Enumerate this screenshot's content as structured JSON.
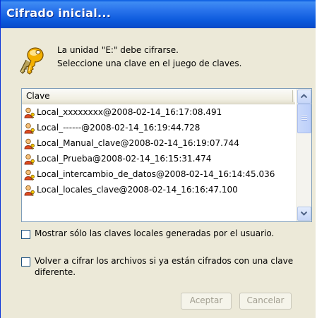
{
  "window": {
    "title": "Cifrado inicial..."
  },
  "message": {
    "line1": "La unidad \"E:\" debe cifrarse.",
    "line2": "Seleccione una clave en el juego de claves."
  },
  "key_list": {
    "column_header": "Clave",
    "items": [
      {
        "label": "Local_xxxxxxxx@2008-02-14_16:17:08.491",
        "icon": "user-key-icon"
      },
      {
        "label": "Local_------@2008-02-14_16:19:44.728",
        "icon": "user-key-icon"
      },
      {
        "label": "Local_Manual_clave@2008-02-14_16:19:07.744",
        "icon": "user-key-icon"
      },
      {
        "label": "Local_Prueba@2008-02-14_16:15:31.474",
        "icon": "user-key-icon"
      },
      {
        "label": "Local_intercambio_de_datos@2008-02-14_16:14:45.036",
        "icon": "user-key-icon"
      },
      {
        "label": "Local_locales_clave@2008-02-14_16:16:47.100",
        "icon": "user-key-icon"
      }
    ]
  },
  "options": {
    "show_local_only": {
      "label": "Mostrar sólo las claves locales generadas por el usuario.",
      "checked": false
    },
    "reencrypt": {
      "label_line1": "Volver a cifrar los archivos si ya están cifrados con una clave",
      "label_line2": "diferente.",
      "checked": false
    }
  },
  "buttons": {
    "accept": "Aceptar",
    "cancel": "Cancelar"
  },
  "colors": {
    "title_bar": "#0a58db",
    "dialog_bg": "#ece9d8",
    "disabled_text": "#a19e90"
  }
}
